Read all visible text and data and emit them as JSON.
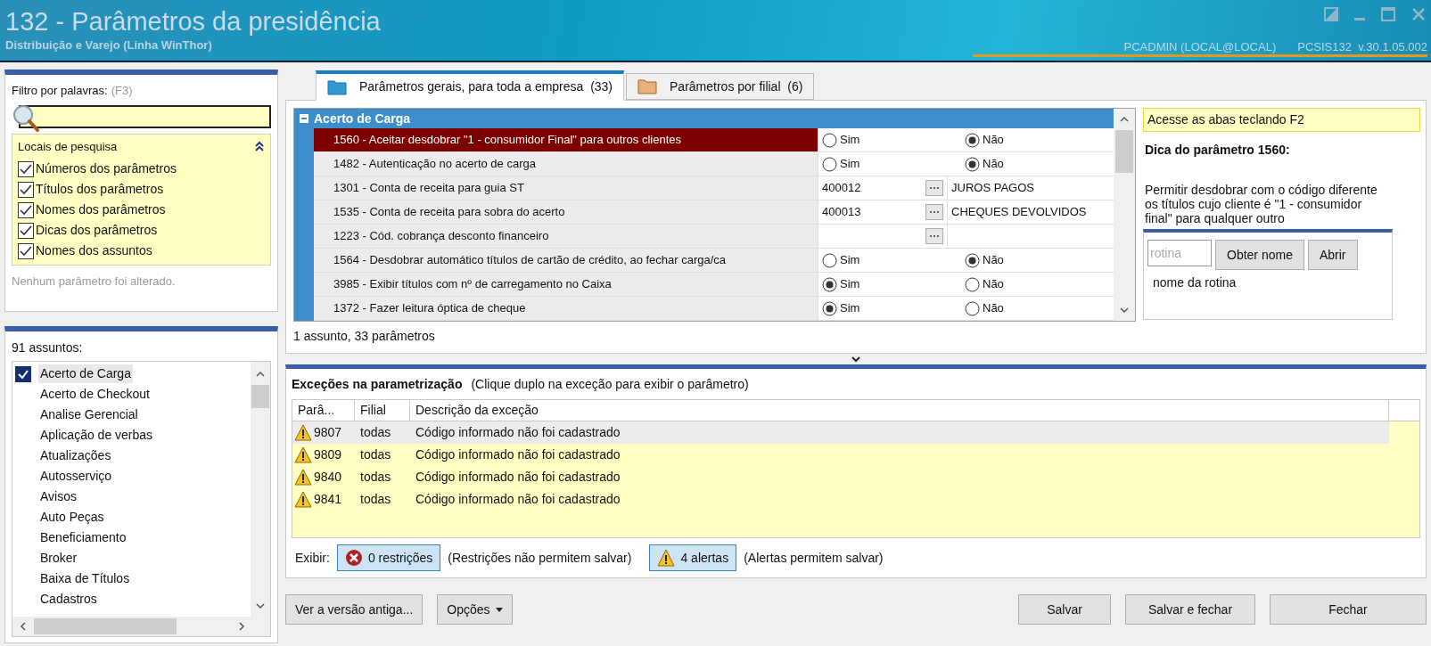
{
  "window": {
    "title": "132 - Parâmetros da presidência",
    "subtitle": "Distribuição e Varejo (Linha WinThor)",
    "user": "PCADMIN (LOCAL@LOCAL)",
    "version": "PCSIS132  v.30.1.05.002"
  },
  "filter": {
    "label": "Filtro por palavras:",
    "shortcut": "(F3)",
    "search_title": "Locais de pesquisa",
    "expanded": true,
    "locations": [
      {
        "label": "Números dos parâmetros",
        "checked": true
      },
      {
        "label": "Títulos dos parâmetros",
        "checked": true
      },
      {
        "label": "Nomes dos parâmetros",
        "checked": true
      },
      {
        "label": "Dicas dos parâmetros",
        "checked": true
      },
      {
        "label": "Nomes dos assuntos",
        "checked": true
      }
    ],
    "status": "Nenhum parâmetro foi alterado."
  },
  "subjects": {
    "label": "91 assuntos:",
    "items": [
      {
        "label": "Acerto de Carga",
        "checked": true,
        "selected": true
      },
      {
        "label": "Acerto de Checkout",
        "checked": false,
        "selected": false
      },
      {
        "label": "Analise Gerencial",
        "checked": false,
        "selected": false
      },
      {
        "label": "Aplicação de verbas",
        "checked": false,
        "selected": false
      },
      {
        "label": "Atualizações",
        "checked": false,
        "selected": false
      },
      {
        "label": "Autosserviço",
        "checked": false,
        "selected": false
      },
      {
        "label": "Avisos",
        "checked": false,
        "selected": false
      },
      {
        "label": "Auto Peças",
        "checked": false,
        "selected": false
      },
      {
        "label": "Beneficiamento",
        "checked": false,
        "selected": false
      },
      {
        "label": "Broker",
        "checked": false,
        "selected": false
      },
      {
        "label": "Baixa de Títulos",
        "checked": false,
        "selected": false
      },
      {
        "label": "Cadastros",
        "checked": false,
        "selected": false
      }
    ]
  },
  "tabs": [
    {
      "label": "Parâmetros gerais, para toda a empresa",
      "count": "(33)",
      "selected": true
    },
    {
      "label": "Parâmetros por filial",
      "count": "(6)",
      "selected": false
    }
  ],
  "grid": {
    "group": "Acerto de Carga",
    "expanded": true,
    "rows": [
      {
        "title": "1560 - Aceitar desdobrar \"1 - consumidor Final\" para outros clientes",
        "selected": true,
        "kind": "radio",
        "options": [
          {
            "label": "Sim",
            "selected": false
          },
          {
            "label": "Não",
            "selected": true
          }
        ]
      },
      {
        "title": "1482 - Autenticação no acerto de carga",
        "selected": false,
        "kind": "radio",
        "options": [
          {
            "label": "Sim",
            "selected": false
          },
          {
            "label": "Não",
            "selected": true
          }
        ]
      },
      {
        "title": "1301 - Conta de receita para guia ST",
        "selected": false,
        "kind": "lookup",
        "code": "400012",
        "description": "JUROS PAGOS"
      },
      {
        "title": "1535 - Conta de receita para sobra do acerto",
        "selected": false,
        "kind": "lookup",
        "code": "400013",
        "description": "CHEQUES DEVOLVIDOS"
      },
      {
        "title": "1223 - Cód. cobrança desconto financeiro",
        "selected": false,
        "kind": "lookup"
      },
      {
        "title": "1564 - Desdobrar automático títulos de cartão de crédito, ao fechar carga/ca",
        "selected": false,
        "kind": "radio",
        "options": [
          {
            "label": "Sim",
            "selected": false
          },
          {
            "label": "Não",
            "selected": true
          }
        ]
      },
      {
        "title": "3985 - Exibir títulos com nº de carregamento no Caixa",
        "selected": false,
        "kind": "radio",
        "options": [
          {
            "label": "Sim",
            "selected": true
          },
          {
            "label": "Não",
            "selected": false
          }
        ]
      },
      {
        "title": "1372 - Fazer leitura óptica de cheque",
        "selected": false,
        "kind": "radio",
        "options": [
          {
            "label": "Sim",
            "selected": true
          },
          {
            "label": "Não",
            "selected": false
          }
        ]
      }
    ],
    "summary": "1 assunto, 33 parâmetros"
  },
  "hint": {
    "tip": "Acesse as abas teclando F2",
    "title": "Dica do parâmetro 1560:",
    "text": "Permitir desdobrar com o código diferente os títulos cujo cliente é \"1 - consumidor final\" para qualquer outro",
    "routine_placeholder": "rotina",
    "buttons": [
      "Obter nome",
      "Abrir"
    ],
    "routine_name": "nome da rotina"
  },
  "exceptions": {
    "title": "Exceções na parametrização",
    "subtitle": "(Clique duplo na exceção para exibir o parâmetro)",
    "columns": [
      "Parâ...",
      "Filial",
      "Descrição da exceção"
    ],
    "rows": [
      {
        "param": "9807",
        "branch": "todas",
        "description": "Código informado não foi cadastrado",
        "selected": true
      },
      {
        "param": "9809",
        "branch": "todas",
        "description": "Código informado não foi cadastrado",
        "selected": false
      },
      {
        "param": "9840",
        "branch": "todas",
        "description": "Código informado não foi cadastrado",
        "selected": false
      },
      {
        "param": "9841",
        "branch": "todas",
        "description": "Código informado não foi cadastrado",
        "selected": false
      }
    ],
    "show_label": "Exibir:",
    "filters": [
      {
        "kind": "error",
        "label": "0 restrições",
        "note": "(Restrições não permitem salvar)"
      },
      {
        "kind": "warning",
        "label": "4 alertas",
        "note": "(Alertas permitem salvar)"
      }
    ]
  },
  "footer": {
    "left": [
      {
        "label": "Ver a versão antiga...",
        "dropdown": false
      },
      {
        "label": "Opções",
        "dropdown": true
      }
    ],
    "right": [
      "Salvar",
      "Salvar e fechar",
      "Fechar"
    ]
  }
}
